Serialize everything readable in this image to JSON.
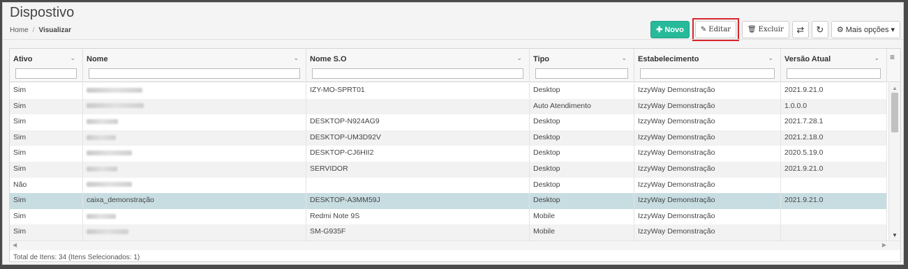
{
  "page": {
    "title": "Dispostivo"
  },
  "breadcrumb": {
    "home": "Home",
    "separator": "/",
    "current": "Visualizar"
  },
  "toolbar": {
    "novo_label": "Novo",
    "editar_label": "Editar",
    "excluir_label": "Excluir",
    "mais_label": "Mais opções",
    "accent_color": "#26b99a",
    "highlight_color": "#d9262c"
  },
  "grid": {
    "columns": [
      "Ativo",
      "Nome",
      "Nome S.O",
      "Tipo",
      "Estabelecimento",
      "Versão Atual"
    ],
    "rows": [
      {
        "ativo": "Sim",
        "nome": "",
        "so": "IZY-MO-SPRT01",
        "tipo": "Desktop",
        "estab": "IzzyWay Demonstração",
        "versao": "2021.9.21.0"
      },
      {
        "ativo": "Sim",
        "nome": "",
        "so": "",
        "tipo": "Auto Atendimento",
        "estab": "IzzyWay Demonstração",
        "versao": "1.0.0.0"
      },
      {
        "ativo": "Sim",
        "nome": "",
        "so": "DESKTOP-N924AG9",
        "tipo": "Desktop",
        "estab": "IzzyWay Demonstração",
        "versao": "2021.7.28.1"
      },
      {
        "ativo": "Sim",
        "nome": "",
        "so": "DESKTOP-UM3D92V",
        "tipo": "Desktop",
        "estab": "IzzyWay Demonstração",
        "versao": "2021.2.18.0"
      },
      {
        "ativo": "Sim",
        "nome": "",
        "so": "DESKTOP-CJ6HII2",
        "tipo": "Desktop",
        "estab": "IzzyWay Demonstração",
        "versao": "2020.5.19.0"
      },
      {
        "ativo": "Sim",
        "nome": "",
        "so": "SERVIDOR",
        "tipo": "Desktop",
        "estab": "IzzyWay Demonstração",
        "versao": "2021.9.21.0"
      },
      {
        "ativo": "Não",
        "nome": "",
        "so": "",
        "tipo": "Desktop",
        "estab": "IzzyWay Demonstração",
        "versao": ""
      },
      {
        "ativo": "Sim",
        "nome": "caixa_demonstração",
        "so": "DESKTOP-A3MM59J",
        "tipo": "Desktop",
        "estab": "IzzyWay Demonstração",
        "versao": "2021.9.21.0",
        "selected": true
      },
      {
        "ativo": "Sim",
        "nome": "",
        "so": "Redmi Note 9S",
        "tipo": "Mobile",
        "estab": "IzzyWay Demonstração",
        "versao": ""
      },
      {
        "ativo": "Sim",
        "nome": "",
        "so": "SM-G935F",
        "tipo": "Mobile",
        "estab": "IzzyWay Demonstração",
        "versao": ""
      }
    ],
    "selected_row_color": "#c8dde2"
  },
  "footer": {
    "summary": "Total de Itens: 34 (Itens Selecionados: 1)"
  }
}
